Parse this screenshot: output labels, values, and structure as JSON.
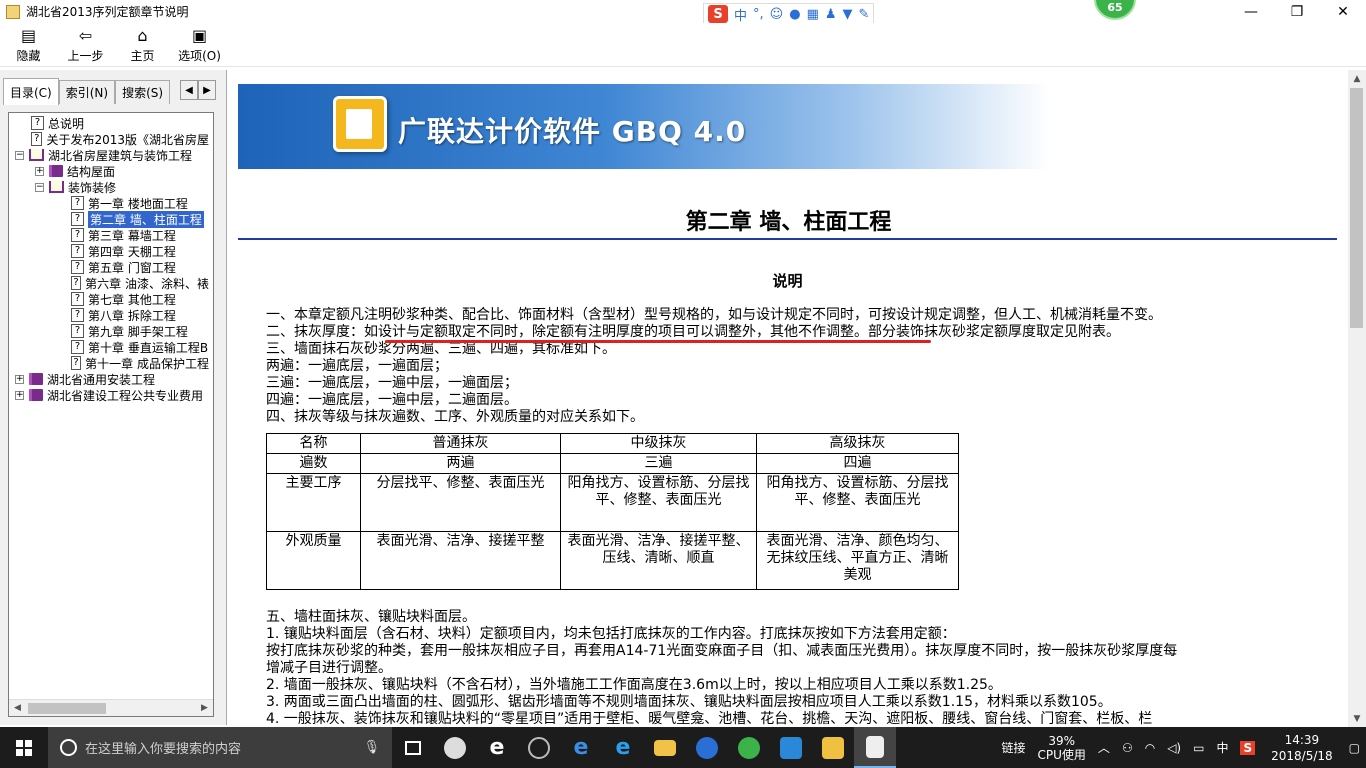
{
  "window": {
    "title": "湖北省2013序列定额章节说明"
  },
  "ime": {
    "brand": "S",
    "lang": "中",
    "punct": "°,"
  },
  "badge": {
    "value": "65"
  },
  "toolbar": {
    "items": [
      {
        "label": "隐藏",
        "icon": "hide-icon"
      },
      {
        "label": "上一步",
        "icon": "back-icon"
      },
      {
        "label": "主页",
        "icon": "home-icon"
      },
      {
        "label": "选项(O)",
        "icon": "options-icon"
      }
    ]
  },
  "tabs": [
    {
      "label": "目录(C)",
      "active": true
    },
    {
      "label": "索引(N)",
      "active": false
    },
    {
      "label": "搜索(S)",
      "active": false
    }
  ],
  "tree": [
    {
      "level": 1,
      "type": "page",
      "label": "总说明"
    },
    {
      "level": 1,
      "type": "page",
      "label": "关于发布2013版《湖北省房屋"
    },
    {
      "level": 0,
      "type": "open",
      "expander": "−",
      "label": "湖北省房屋建筑与装饰工程"
    },
    {
      "level": 1,
      "type": "book",
      "expander": "+",
      "label": "结构屋面"
    },
    {
      "level": 1,
      "type": "open",
      "expander": "−",
      "label": "装饰装修"
    },
    {
      "level": 2,
      "type": "page",
      "label": "第一章 楼地面工程"
    },
    {
      "level": 2,
      "type": "page",
      "label": "第二章 墙、柱面工程",
      "selected": true
    },
    {
      "level": 2,
      "type": "page",
      "label": "第三章 幕墙工程"
    },
    {
      "level": 2,
      "type": "page",
      "label": "第四章 天棚工程"
    },
    {
      "level": 2,
      "type": "page",
      "label": "第五章 门窗工程"
    },
    {
      "level": 2,
      "type": "page",
      "label": "第六章 油漆、涂料、裱"
    },
    {
      "level": 2,
      "type": "page",
      "label": "第七章 其他工程"
    },
    {
      "level": 2,
      "type": "page",
      "label": "第八章 拆除工程"
    },
    {
      "level": 2,
      "type": "page",
      "label": "第九章 脚手架工程"
    },
    {
      "level": 2,
      "type": "page",
      "label": "第十章 垂直运输工程B"
    },
    {
      "level": 2,
      "type": "page",
      "label": "第十一章 成品保护工程"
    },
    {
      "level": 0,
      "type": "book",
      "expander": "+",
      "label": "湖北省通用安装工程"
    },
    {
      "level": 0,
      "type": "book",
      "expander": "+",
      "label": "湖北省建设工程公共专业费用"
    }
  ],
  "banner": {
    "text": "广联达计价软件 GBQ 4.0"
  },
  "doc": {
    "chapter_title": "第二章  墙、柱面工程",
    "section_title": "说明",
    "para1": "一、本章定额凡注明砂浆种类、配合比、饰面材料（含型材）型号规格的，如与设计规定不同时，可按设计规定调整，但人工、机械消耗量不变。",
    "para2_a": "二、抹灰厚度：",
    "para2_b": "如设计与定额取定不同时，除定额有注明厚度的项目可以调整外，其他不作调整",
    "para2_c": "。部分装饰抹灰砂浆定额厚度取定见附表。",
    "para3": "三、墙面抹石灰砂浆分两遍、三遍、四遍，其标准如下。",
    "para4": "两遍：一遍底层，一遍面层；",
    "para5": "三遍：一遍底层，一遍中层，一遍面层；",
    "para6": "四遍：一遍底层，一遍中层，二遍面层。",
    "para7": "四、抹灰等级与抹灰遍数、工序、外观质量的对应关系如下。",
    "table": {
      "header": [
        "名称",
        "普通抹灰",
        "中级抹灰",
        "高级抹灰"
      ],
      "row_passes": [
        "遍数",
        "两遍",
        "三遍",
        "四遍"
      ],
      "row_process": [
        "主要工序",
        "分层找平、修整、表面压光",
        "阳角找方、设置标筋、分层找平、修整、表面压光",
        "阳角找方、设置标筋、分层找平、修整、表面压光"
      ],
      "row_quality": [
        "外观质量",
        "表面光滑、洁净、接搓平整",
        "表面光滑、洁净、接搓平整、压线、清晰、顺直",
        "表面光滑、洁净、颜色均匀、无抹纹压线、平直方正、清晰美观"
      ]
    },
    "para8": "五、墙柱面抹灰、镶贴块料面层。",
    "para9": "1. 镶贴块料面层（含石材、块料）定额项目内，均未包括打底抹灰的工作内容。打底抹灰按如下方法套用定额：",
    "para10": "按打底抹灰砂浆的种类，套用一般抹灰相应子目，再套用A14-71光面变麻面子目（扣、减表面压光费用）。抹灰厚度不同时，按一般抹灰砂浆厚度每",
    "para11": "增减子目进行调整。",
    "para12": "2. 墙面一般抹灰、镶贴块料（不含石材），当外墙施工工作面高度在3.6m以上时，按以上相应项目人工乘以系数1.25。",
    "para13": "3. 两面或三面凸出墙面的柱、圆弧形、锯齿形墙面等不规则墙面抹灰、镶贴块料面层按相应项目人工乘以系数1.15，材料乘以系数105。",
    "para14": "4. 一般抹灰、装饰抹灰和镶贴块料的“零星项目”适用于壁柜、暖气壁龛、池槽、花台、挑檐、天沟、遮阳板、腰线、窗台线、门窗套、栏板、栏"
  },
  "taskbar": {
    "search_placeholder": "在这里输入你要搜索的内容",
    "tray_link": "链接",
    "cpu_percent": "39%",
    "cpu_label": "CPU使用",
    "ime_lang": "中",
    "time": "14:39",
    "date": "2018/5/18"
  }
}
